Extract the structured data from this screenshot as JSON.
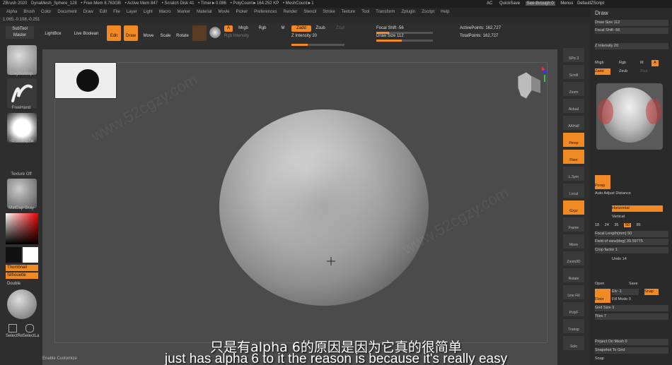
{
  "titlebar": {
    "items": [
      "ZBrush 2020",
      "DynaMesh_Sphere_128",
      "• Free Mem 8.763GB",
      "• Active Mem 847",
      "• Scratch Disk 41",
      "• Timer►0.086",
      "• PolyCount►164.252 KP",
      "• MeshCount►1"
    ]
  },
  "topright": {
    "ac": "AC",
    "quicksave": "QuickSave",
    "seethrough": "See-through 0",
    "menus": "Menus",
    "script": "DefaultZScript"
  },
  "menubar": [
    "Alpha",
    "Brush",
    "Color",
    "Document",
    "Draw",
    "Edit",
    "File",
    "Layer",
    "Light",
    "Macro",
    "Marker",
    "Material",
    "Movie",
    "Picker",
    "Preferences",
    "Render",
    "Stencil",
    "Stroke",
    "Texture",
    "Tool",
    "Transform",
    "Zplugin",
    "Zscript",
    "Help"
  ],
  "coords": "1.065,-0.108,-0.251",
  "toolbar": {
    "subtool_master": "SubTool Master",
    "lightbox": "LightBox",
    "live_boolean": "Live Boolean",
    "edit": "Edit",
    "draw": "Draw",
    "move": "Move",
    "scale": "Scale",
    "rotate": "Rotate",
    "a": "A",
    "mrgb": "Mrgb",
    "rgb": "Rgb",
    "m": "M",
    "zadd": "Zadd",
    "zsub": "Zsub",
    "zcut": "Zcut",
    "rgb_intensity": "Rgb Intensity",
    "z_intensity": "Z Intensity 20",
    "focal_shift": "Focal Shift -56",
    "draw_size": "Draw Size 112",
    "active_points": "ActivePoints: 162,727",
    "total_points": "TotalPoints: 162,727"
  },
  "left": {
    "clay": "ClayBuildup",
    "freehand": "FreeHand",
    "brushalpha": "~BrushAlpha",
    "texture": "Texture Off",
    "matcap": "MatCap Gray",
    "thumbnail": "Thumbnail",
    "silhouette": "Silhouette",
    "double": "Double",
    "selectrect": "SelectRe",
    "selectlasso": "SelectLa"
  },
  "shelf": [
    "SPix 3",
    "Scroll",
    "Zoom",
    "Actual",
    "AAHalf",
    "Persp",
    "Floor",
    "L.Sym",
    "Local",
    "Gxyz",
    "Frame",
    "Move",
    "Zoom3D",
    "Rotate",
    "Line Fill",
    "PolyF",
    "Transp",
    "Solo"
  ],
  "tray": {
    "title": "Draw",
    "draw_size": "Draw Size 112",
    "focal_shift": "Focal Shift -56",
    "z_intensity": "Z Intensity 20",
    "mrgb": "Mrgb",
    "rgb": "Rgb",
    "m": "M",
    "a": "A",
    "zadd": "Zadd",
    "zsub": "Zsub",
    "zcut": "Zcut",
    "persp": "Persp",
    "auto_adjust": "Auto Adjust Distance",
    "horizontal": "Horizontal",
    "vertical": "Vertical",
    "focal_values": [
      "18",
      "24",
      "35",
      "50",
      "85"
    ],
    "focal_length": "Focal Length(mm) 50",
    "field_of_view": "Field of view(deg) 39.59775",
    "crop_factor": "Crop factor 1",
    "undo": "Undo 14",
    "open": "Open",
    "save": "Save",
    "floor": "Floor",
    "elv": "Elv -1",
    "snap": "Snap",
    "fill_mode": "Fill Mode 0",
    "grid_size": "Grid Size 3",
    "tiles": "Tiles 7",
    "project": "Project On Mesh 0",
    "snapshot": "Snapshot To Grid",
    "snap2": "Snap"
  },
  "status": "Enable Customize",
  "subtitle_zh": "只是有alpha 6的原因是因为它真的很简单",
  "subtitle_en": "just has alpha 6 to it the reason is because it's really easy",
  "watermark": "www.52cgzy.com",
  "colors": {
    "accent": "#f08a24",
    "bg": "#2b2b2b",
    "viewport": "#4b4b4b"
  }
}
